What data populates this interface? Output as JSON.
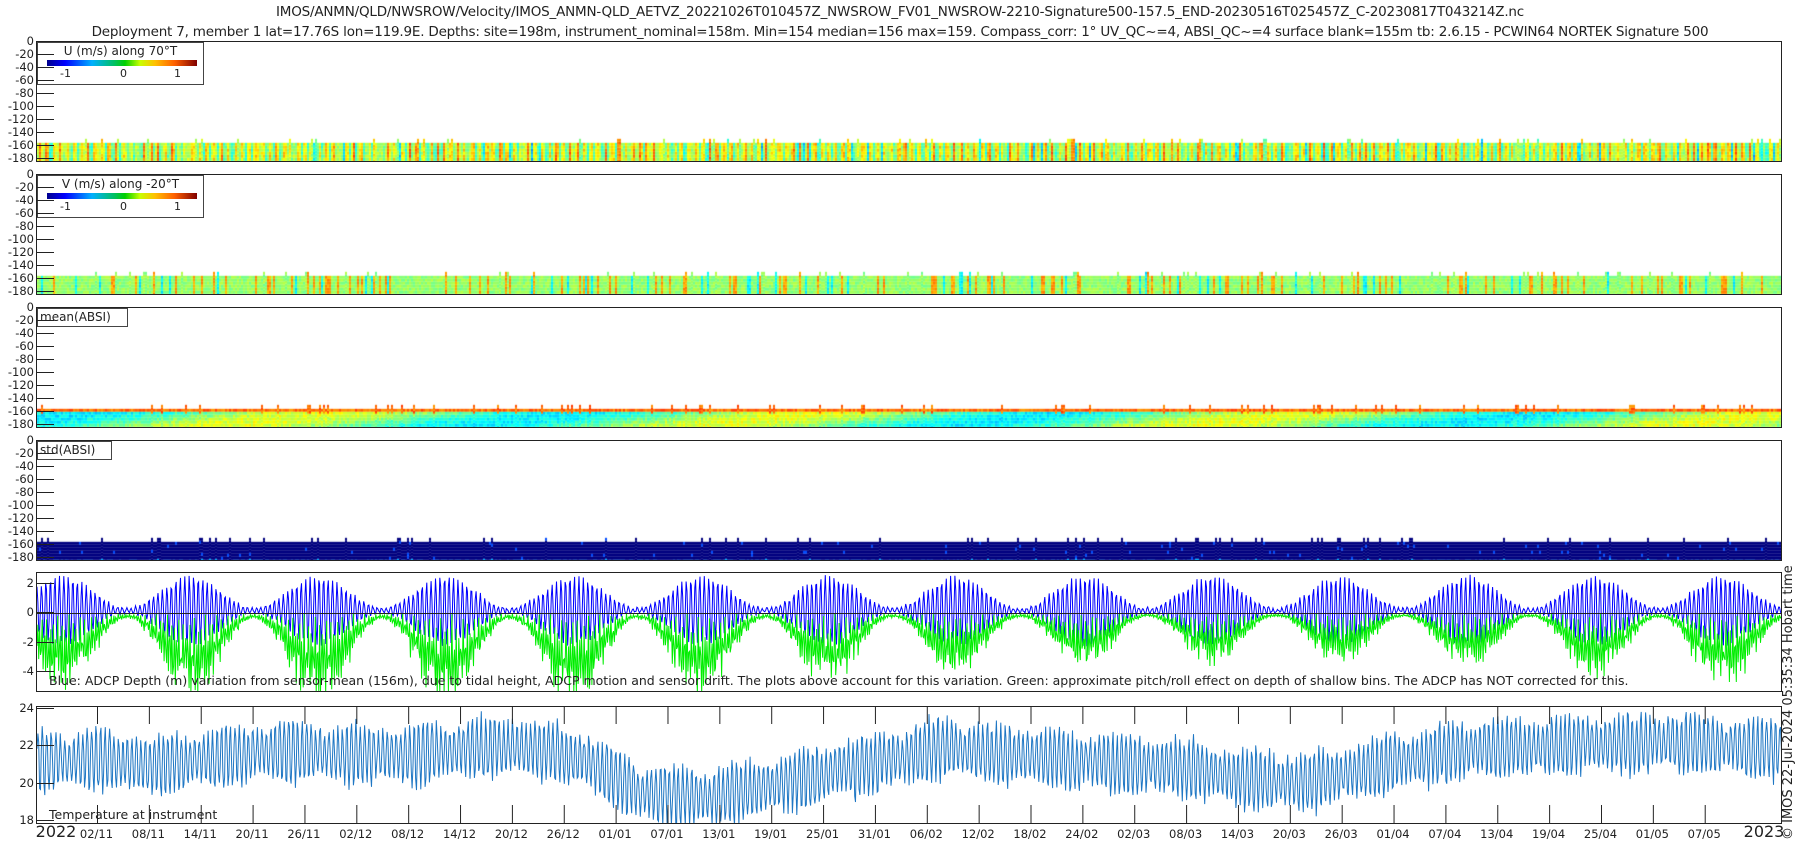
{
  "header": {
    "title": "IMOS/ANMN/QLD/NWSROW/Velocity/IMOS_ANMN-QLD_AETVZ_20221026T010457Z_NWSROW_FV01_NWSROW-2210-Signature500-157.5_END-20230516T025457Z_C-20230817T043214Z.nc",
    "subtitle": "Deployment 7, member 1 lat=17.76S lon=119.9E. Depths: site=198m, instrument_nominal=158m. Min=154 median=156 max=159. Compass_corr: 1° UV_QC~=4, ABSI_QC~=4 surface blank=155m tb: 2.6.15 - PCWIN64 NORTEK Signature 500"
  },
  "credit": "© IMOS 22-Jul-2024 05:35:34 Hobart time",
  "colors": {
    "depth_blue": "#0000ff",
    "pitch_green": "#00ee00",
    "temp": "#1f77c4",
    "std_bg": "#00008f"
  },
  "chart_data": [
    {
      "type": "heatmap",
      "name": "u",
      "legend_title": "U (m/s) along 70°T",
      "colorbar_ticks": [
        "-1",
        "0",
        "1"
      ],
      "clim": [
        -1.25,
        1.25
      ],
      "ylim": [
        -186,
        0
      ],
      "yticks": [
        "0",
        "-20",
        "-40",
        "-60",
        "-80",
        "-100",
        "-120",
        "-140",
        "-160",
        "-180"
      ],
      "data_depth_range": [
        -186,
        -155
      ],
      "typical_value": 0.15
    },
    {
      "type": "heatmap",
      "name": "v",
      "legend_title": "V (m/s) along -20°T",
      "colorbar_ticks": [
        "-1",
        "0",
        "1"
      ],
      "clim": [
        -1.25,
        1.25
      ],
      "ylim": [
        -186,
        0
      ],
      "yticks": [
        "0",
        "-20",
        "-40",
        "-60",
        "-80",
        "-100",
        "-120",
        "-140",
        "-160",
        "-180"
      ],
      "data_depth_range": [
        -186,
        -155
      ],
      "typical_value": 0.05
    },
    {
      "type": "heatmap",
      "name": "mean_absi",
      "label": "mean(ABSI)",
      "ylim": [
        -186,
        0
      ],
      "yticks": [
        "0",
        "-20",
        "-40",
        "-60",
        "-80",
        "-100",
        "-120",
        "-140",
        "-160",
        "-180"
      ],
      "data_depth_range": [
        -186,
        -155
      ]
    },
    {
      "type": "heatmap",
      "name": "std_absi",
      "label": "std(ABSI)",
      "ylim": [
        -186,
        0
      ],
      "yticks": [
        "0",
        "-20",
        "-40",
        "-60",
        "-80",
        "-100",
        "-120",
        "-140",
        "-160",
        "-180"
      ],
      "data_depth_range": [
        -186,
        -155
      ]
    },
    {
      "type": "line",
      "name": "depth_variation",
      "ylim": [
        -5.4,
        2.75
      ],
      "yticks": [
        {
          "v": 2,
          "l": "2"
        },
        {
          "v": 0,
          "l": "0"
        },
        {
          "v": -2,
          "l": "-2"
        },
        {
          "v": -4,
          "l": "-4"
        }
      ],
      "annotation": "Blue: ADCP Depth (m) variation from sensor-mean (156m), due to tidal height, ADCP motion and sensor drift. The plots above account for this variation. Green: approximate pitch/roll effect on depth of shallow bins. The ADCP has NOT corrected for this.",
      "series": [
        {
          "name": "ADCP depth variation",
          "color": "#0000ff",
          "max_amplitude_m": 2.6
        },
        {
          "name": "pitch/roll effect",
          "color": "#00ee00",
          "max_amplitude_m": -5.4
        }
      ]
    },
    {
      "type": "line",
      "name": "temperature",
      "ylim": [
        17.8,
        24.1
      ],
      "yticks": [
        {
          "v": 24,
          "l": "24"
        },
        {
          "v": 22,
          "l": "22"
        },
        {
          "v": 20,
          "l": "20"
        },
        {
          "v": 18,
          "l": "18"
        }
      ],
      "annotation": "Temperature at instrument",
      "weekly_mean": [
        21.2,
        21.3,
        21.0,
        21.4,
        21.8,
        21.6,
        21.5,
        21.8,
        22.0,
        21.3,
        19.5,
        19.2,
        19.8,
        20.5,
        21.2,
        21.9,
        21.6,
        21.3,
        21.0,
        20.8,
        20.2,
        20.1,
        20.8,
        21.5,
        21.9,
        22.0,
        22.1,
        22.2,
        22.0,
        21.8
      ],
      "series": [
        {
          "name": "Temperature",
          "color": "#1f77c4"
        }
      ]
    }
  ],
  "xaxis": {
    "start_label": "2022",
    "end_label": "2023",
    "ticks": [
      "02/11",
      "08/11",
      "14/11",
      "20/11",
      "26/11",
      "02/12",
      "08/12",
      "14/12",
      "20/12",
      "26/12",
      "01/01",
      "07/01",
      "13/01",
      "19/01",
      "25/01",
      "31/01",
      "06/02",
      "12/02",
      "18/02",
      "24/02",
      "02/03",
      "08/03",
      "14/03",
      "20/03",
      "26/03",
      "01/04",
      "07/04",
      "13/04",
      "19/04",
      "25/04",
      "01/05",
      "07/05"
    ],
    "first_tick_day": 7,
    "tick_step_days": 6,
    "total_days": 202
  }
}
